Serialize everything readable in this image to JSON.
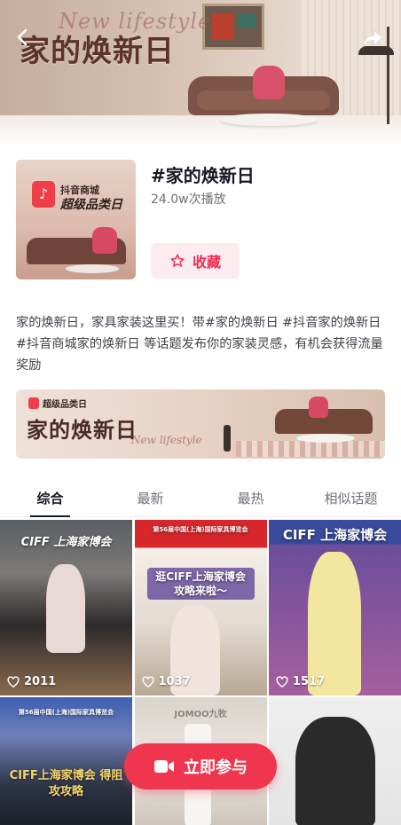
{
  "hero": {
    "script_text": "New lifestyle",
    "title": "家的焕新日"
  },
  "topic": {
    "cover_line1": "抖音商城",
    "cover_line2": "超级品类日",
    "title": "#家的焕新日",
    "plays": "24.0w次播放",
    "favorite_label": "收藏"
  },
  "description": "家的焕新日，家具家装这里买！带#家的焕新日 #抖音家的焕新日 #抖音商城家的焕新日 等话题发布你的家装灵感，有机会获得流量奖励",
  "banner": {
    "badge": "超级品类日",
    "title": "家的焕新日",
    "script_text": "New lifestyle"
  },
  "tabs": [
    {
      "label": "综合",
      "active": true
    },
    {
      "label": "最新",
      "active": false
    },
    {
      "label": "最热",
      "active": false
    },
    {
      "label": "相似话题",
      "active": false
    }
  ],
  "videos": [
    {
      "overlay": "CIFF 上海家博会",
      "likes": "2011"
    },
    {
      "overlay": "逛CIFF上海家博会 攻略来啦～",
      "header": "第56届中国(上海)国际家具博览会",
      "likes": "1037"
    },
    {
      "overlay": "CIFF 上海家博会",
      "likes": "1517"
    },
    {
      "overlay": "CIFF上海家博会 得阻攻攻略",
      "header": "第56届中国(上海)国际家具博览会"
    },
    {
      "overlay": "JOMOO九牧"
    },
    {
      "overlay": ""
    }
  ],
  "join_label": "立即参与"
}
